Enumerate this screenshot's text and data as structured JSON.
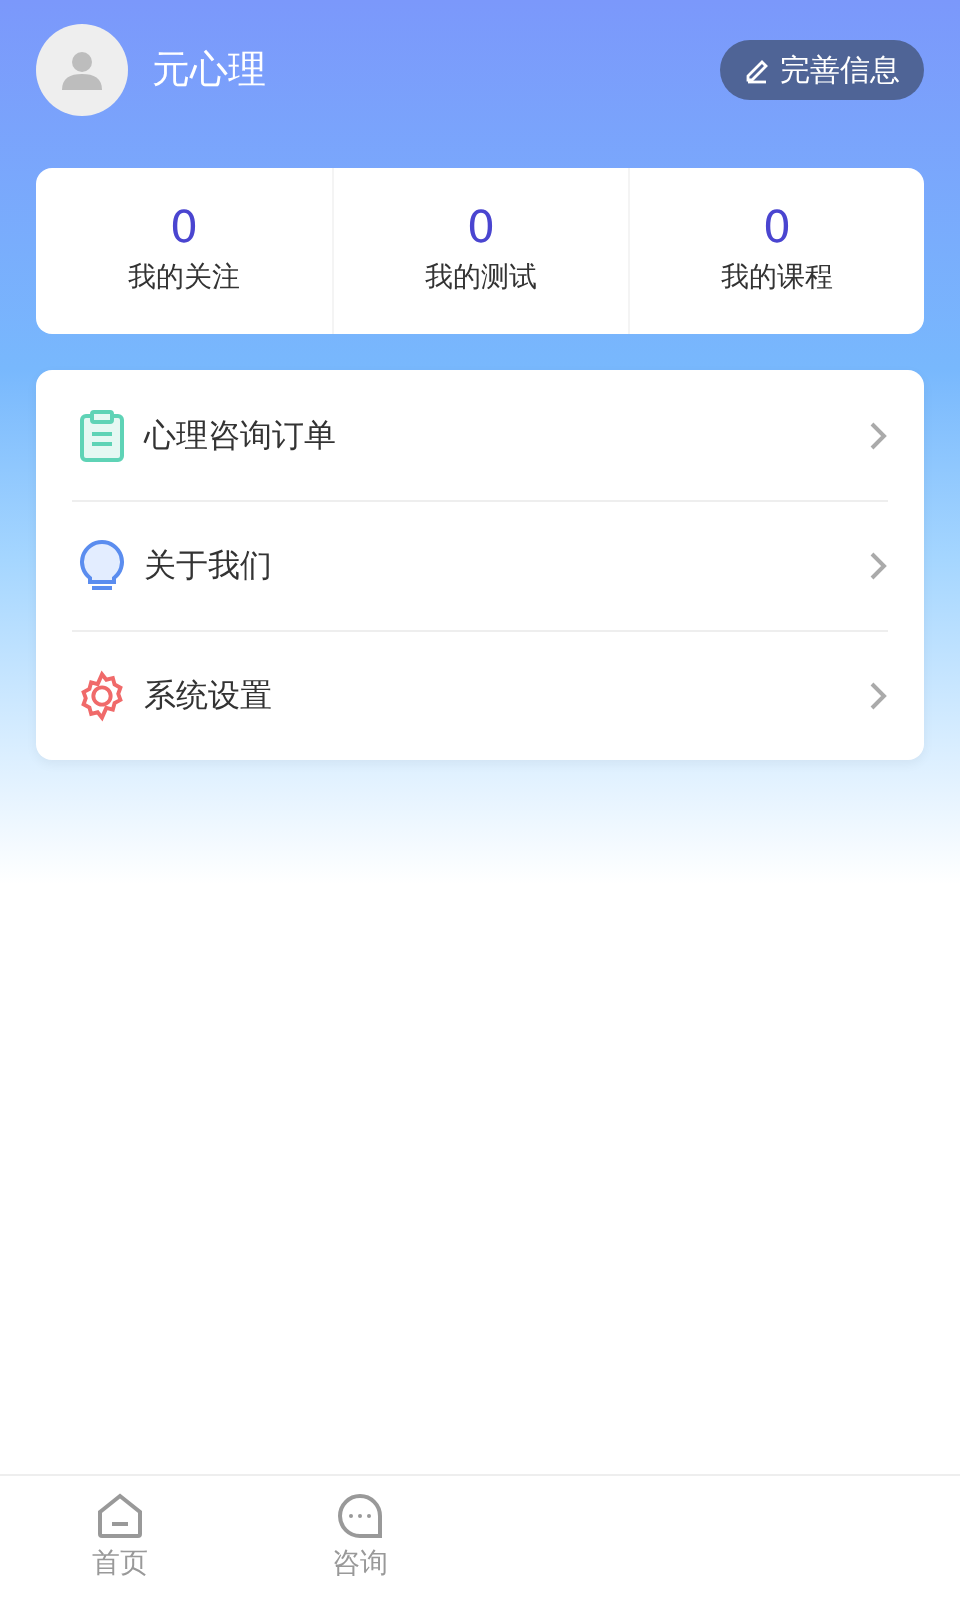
{
  "profile": {
    "name": "元心理",
    "edit_button": "完善信息"
  },
  "stats": [
    {
      "value": "0",
      "label": "我的关注"
    },
    {
      "value": "0",
      "label": "我的测试"
    },
    {
      "value": "0",
      "label": "我的课程"
    }
  ],
  "menu": [
    {
      "kind": "order",
      "label": "心理咨询订单"
    },
    {
      "kind": "about",
      "label": "关于我们"
    },
    {
      "kind": "settings",
      "label": "系统设置"
    }
  ],
  "tab_bar": [
    {
      "kind": "home",
      "label": "首页",
      "selected": false
    },
    {
      "kind": "chat",
      "label": "咨询",
      "selected": false
    }
  ]
}
